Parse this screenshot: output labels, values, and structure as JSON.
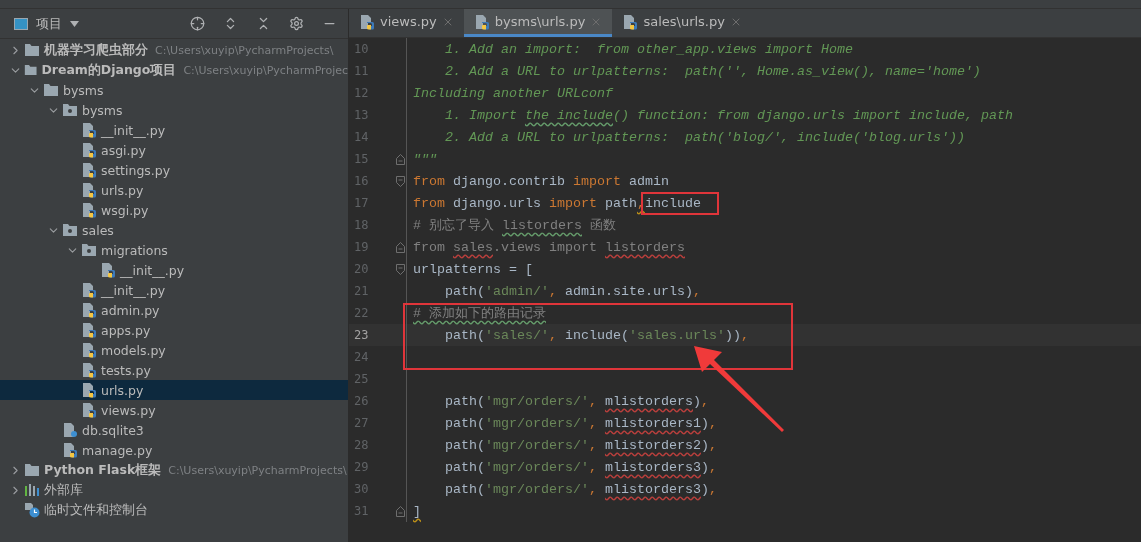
{
  "sidebar": {
    "title": "项目",
    "tree": [
      {
        "label": "机器学习爬虫部分",
        "hint": "C:\\Users\\xuyip\\PycharmProjects\\",
        "kind": "project",
        "expanded": false,
        "selected": false
      },
      {
        "label": "Dream的Django项目",
        "hint": "C:\\Users\\xuyip\\PycharmProjec",
        "kind": "project",
        "expanded": true,
        "selected": false,
        "children": [
          {
            "label": "bysms",
            "kind": "folder",
            "expanded": true,
            "selected": false,
            "children": [
              {
                "label": "bysms",
                "kind": "package",
                "expanded": true,
                "selected": false,
                "children": [
                  {
                    "label": "__init__.py",
                    "kind": "python",
                    "selected": false
                  },
                  {
                    "label": "asgi.py",
                    "kind": "python",
                    "selected": false
                  },
                  {
                    "label": "settings.py",
                    "kind": "python",
                    "selected": false
                  },
                  {
                    "label": "urls.py",
                    "kind": "python",
                    "selected": false
                  },
                  {
                    "label": "wsgi.py",
                    "kind": "python",
                    "selected": false
                  }
                ]
              },
              {
                "label": "sales",
                "kind": "package",
                "expanded": true,
                "selected": false,
                "children": [
                  {
                    "label": "migrations",
                    "kind": "package",
                    "expanded": true,
                    "selected": false,
                    "children": [
                      {
                        "label": "__init__.py",
                        "kind": "python",
                        "selected": false
                      }
                    ]
                  },
                  {
                    "label": "__init__.py",
                    "kind": "python",
                    "selected": false
                  },
                  {
                    "label": "admin.py",
                    "kind": "python",
                    "selected": false
                  },
                  {
                    "label": "apps.py",
                    "kind": "python",
                    "selected": false
                  },
                  {
                    "label": "models.py",
                    "kind": "python",
                    "selected": false
                  },
                  {
                    "label": "tests.py",
                    "kind": "python",
                    "selected": false
                  },
                  {
                    "label": "urls.py",
                    "kind": "python",
                    "selected": true
                  },
                  {
                    "label": "views.py",
                    "kind": "python",
                    "selected": false
                  }
                ]
              },
              {
                "label": "db.sqlite3",
                "kind": "database",
                "selected": false
              },
              {
                "label": "manage.py",
                "kind": "python",
                "selected": false
              }
            ]
          }
        ]
      },
      {
        "label": "Python Flask框架",
        "hint": "C:\\Users\\xuyip\\PycharmProjects\\",
        "kind": "project",
        "expanded": false,
        "selected": false
      },
      {
        "label": "外部库",
        "kind": "library",
        "expanded": false,
        "selected": false
      },
      {
        "label": "临时文件和控制台",
        "kind": "scratch",
        "selected": false
      }
    ]
  },
  "tabs": [
    {
      "label": "views.py",
      "selected": false
    },
    {
      "label": "bysms\\urls.py",
      "selected": true
    },
    {
      "label": "sales\\urls.py",
      "selected": false
    }
  ],
  "editor": {
    "lines": [
      {
        "number": "10",
        "current": false,
        "framed": false,
        "tokens": [
          {
            "text": "    1. Add an import:  from other_app.views import Home",
            "kind": "doc"
          }
        ]
      },
      {
        "number": "11",
        "current": false,
        "framed": false,
        "tokens": [
          {
            "text": "    2. Add a URL to urlpatterns:  path('', Home.as_view(), name='home')",
            "kind": "doc"
          }
        ]
      },
      {
        "number": "12",
        "current": false,
        "framed": false,
        "tokens": [
          {
            "text": "Including another URLconf",
            "kind": "doc"
          }
        ]
      },
      {
        "number": "13",
        "current": false,
        "framed": false,
        "tokens": [
          {
            "text": "    1. Import ",
            "kind": "doc"
          },
          {
            "text": "the include",
            "kind": "doc",
            "typo": true
          },
          {
            "text": "() function: from django.urls import include, path",
            "kind": "doc"
          }
        ]
      },
      {
        "number": "14",
        "current": false,
        "framed": false,
        "tokens": [
          {
            "text": "    2. Add a URL to urlpatterns:  path('blog/', include('blog.urls'))",
            "kind": "doc"
          }
        ]
      },
      {
        "number": "15",
        "current": false,
        "framed": false,
        "fold_end": true,
        "tokens": [
          {
            "text": "\"\"\"",
            "kind": "doc"
          }
        ]
      },
      {
        "number": "16",
        "current": false,
        "framed": false,
        "fold_start": true,
        "tokens": [
          {
            "text": "from",
            "kind": "keyword"
          },
          {
            "text": " django.contrib ",
            "kind": "plain"
          },
          {
            "text": "import",
            "kind": "keyword"
          },
          {
            "text": " admin",
            "kind": "plain"
          }
        ]
      },
      {
        "number": "17",
        "current": false,
        "framed": false,
        "tokens": [
          {
            "text": "from",
            "kind": "keyword"
          },
          {
            "text": " django.urls ",
            "kind": "plain"
          },
          {
            "text": "import",
            "kind": "keyword"
          },
          {
            "text": " path",
            "kind": "plain"
          },
          {
            "text": ",",
            "kind": "keyword",
            "warning": true
          },
          {
            "text": "include",
            "kind": "plain",
            "boxed": true
          }
        ]
      },
      {
        "number": "18",
        "current": false,
        "framed": false,
        "tokens": [
          {
            "text": "# 别忘了导入 ",
            "kind": "comment"
          },
          {
            "text": "listorders",
            "kind": "comment",
            "typo": true
          },
          {
            "text": " 函数",
            "kind": "comment"
          }
        ]
      },
      {
        "number": "19",
        "current": false,
        "framed": false,
        "fold_end": true,
        "tokens": [
          {
            "text": "from ",
            "kind": "unused"
          },
          {
            "text": "sales",
            "kind": "unused",
            "error": true
          },
          {
            "text": ".views import ",
            "kind": "unused"
          },
          {
            "text": "listorders",
            "kind": "unused",
            "error": true
          }
        ]
      },
      {
        "number": "20",
        "current": false,
        "framed": false,
        "fold_start": true,
        "tokens": [
          {
            "text": "urlpatterns = [",
            "kind": "plain"
          }
        ]
      },
      {
        "number": "21",
        "current": false,
        "framed": false,
        "tokens": [
          {
            "text": "    path(",
            "kind": "plain"
          },
          {
            "text": "'admin/'",
            "kind": "string"
          },
          {
            "text": ",",
            "kind": "keyword"
          },
          {
            "text": " admin.site.urls)",
            "kind": "plain"
          },
          {
            "text": ",",
            "kind": "keyword"
          }
        ]
      },
      {
        "number": "22",
        "current": false,
        "framed": true,
        "tokens": [
          {
            "text": "# 添加如下的路由记录",
            "kind": "comment",
            "typo": true
          }
        ]
      },
      {
        "number": "23",
        "current": true,
        "framed": true,
        "tokens": [
          {
            "text": "    path(",
            "kind": "plain"
          },
          {
            "text": "'sales/'",
            "kind": "string"
          },
          {
            "text": ",",
            "kind": "keyword"
          },
          {
            "text": " include(",
            "kind": "plain"
          },
          {
            "text": "'sales.urls'",
            "kind": "string"
          },
          {
            "text": "))",
            "kind": "plain"
          },
          {
            "text": ",",
            "kind": "keyword"
          }
        ]
      },
      {
        "number": "24",
        "current": false,
        "framed": true
      },
      {
        "number": "25",
        "current": false,
        "framed": false
      },
      {
        "number": "26",
        "current": false,
        "framed": false,
        "tokens": [
          {
            "text": "    path(",
            "kind": "plain"
          },
          {
            "text": "'mgr/orders/'",
            "kind": "string"
          },
          {
            "text": ", ",
            "kind": "keyword"
          },
          {
            "text": "mlistorders",
            "kind": "plain",
            "error": true
          },
          {
            "text": ")",
            "kind": "plain"
          },
          {
            "text": ",",
            "kind": "keyword"
          }
        ]
      },
      {
        "number": "27",
        "current": false,
        "framed": false,
        "tokens": [
          {
            "text": "    path(",
            "kind": "plain"
          },
          {
            "text": "'mgr/orders/'",
            "kind": "string"
          },
          {
            "text": ", ",
            "kind": "keyword"
          },
          {
            "text": "mlistorders1",
            "kind": "plain",
            "error": true
          },
          {
            "text": ")",
            "kind": "plain"
          },
          {
            "text": ",",
            "kind": "keyword"
          }
        ]
      },
      {
        "number": "28",
        "current": false,
        "framed": false,
        "tokens": [
          {
            "text": "    path(",
            "kind": "plain"
          },
          {
            "text": "'mgr/orders/'",
            "kind": "string"
          },
          {
            "text": ", ",
            "kind": "keyword"
          },
          {
            "text": "mlistorders2",
            "kind": "plain",
            "error": true
          },
          {
            "text": ")",
            "kind": "plain"
          },
          {
            "text": ",",
            "kind": "keyword"
          }
        ]
      },
      {
        "number": "29",
        "current": false,
        "framed": false,
        "tokens": [
          {
            "text": "    path(",
            "kind": "plain"
          },
          {
            "text": "'mgr/orders/'",
            "kind": "string"
          },
          {
            "text": ", ",
            "kind": "keyword"
          },
          {
            "text": "mlistorders3",
            "kind": "plain",
            "error": true
          },
          {
            "text": ")",
            "kind": "plain"
          },
          {
            "text": ",",
            "kind": "keyword"
          }
        ]
      },
      {
        "number": "30",
        "current": false,
        "framed": false,
        "tokens": [
          {
            "text": "    path(",
            "kind": "plain"
          },
          {
            "text": "'mgr/orders/'",
            "kind": "string"
          },
          {
            "text": ", ",
            "kind": "keyword"
          },
          {
            "text": "mlistorders3",
            "kind": "plain",
            "error": true
          },
          {
            "text": ")",
            "kind": "plain"
          },
          {
            "text": ",",
            "kind": "keyword"
          }
        ]
      },
      {
        "number": "31",
        "current": false,
        "framed": false,
        "fold_end": true,
        "tokens": [
          {
            "text": "]",
            "kind": "plain",
            "warning": true
          }
        ]
      }
    ]
  }
}
